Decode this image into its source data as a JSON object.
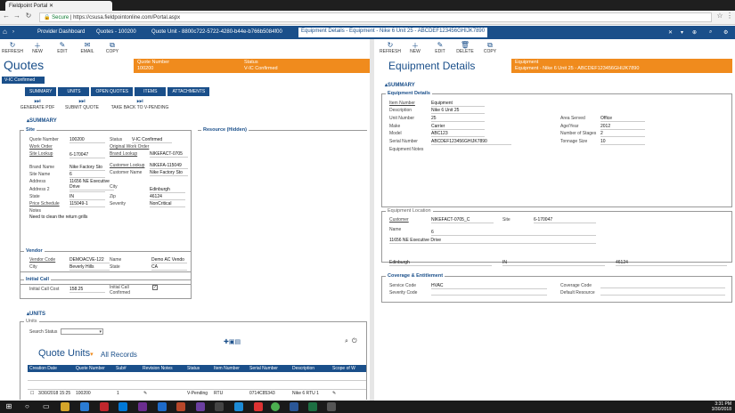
{
  "browser": {
    "tab_title": "Fieldpoint Portal",
    "secure": "Secure",
    "url": "https://csusa.fieldpointonline.com/Portal.aspx"
  },
  "appnav": {
    "items": [
      "Provider Dashboard",
      "Quotes - 100200",
      "Quote Unit - 8800c722-5722-4280-b44e-b766b5084f00",
      "Equipment Details - Equipment - Nike 6 Unit 25 - ABCDEF123456GHIJK7890"
    ]
  },
  "left": {
    "toolbar": [
      "REFRESH",
      "NEW",
      "EDIT",
      "EMAIL",
      "COPY"
    ],
    "title": "Quotes",
    "header": {
      "quote_number_label": "Quote Number",
      "quote_number": "100200",
      "status_label": "Status",
      "status": "V-IC Confirmed"
    },
    "badge": "V-IC Confirmed",
    "subtabs": [
      "SUMMARY",
      "UNITS",
      "OPEN QUOTES",
      "ITEMS",
      "ATTACHMENTS"
    ],
    "actions": [
      "GENERATE PDF",
      "SUBMIT QUOTE",
      "TAKE BACK TO V-PENDING"
    ],
    "summary_heading": "SUMMARY",
    "site_heading": "Site",
    "site": {
      "quote_number_label": "Quote Number",
      "quote_number": "100200",
      "work_order_label": "Work Order",
      "site_lookup_label": "Site Lookup",
      "site_lookup": "6-170047",
      "brand_name_label": "Brand Name",
      "brand_name": "Nike Factory Sto",
      "site_name_label": "Site Name",
      "site_name": "6",
      "address_label": "Address",
      "address": "11656 NE Executive Drive",
      "address2_label": "Address 2",
      "state_label": "State",
      "state": "IN",
      "price_schedule_label": "Price Schedule",
      "price_schedule": "115049-1",
      "notes_label": "Notes",
      "notes": "Need to clean the return grills",
      "status_label": "Status",
      "status": "V-IC Confirmed",
      "orig_wo_label": "Original Work Order",
      "brand_lookup_label": "Brand Lookup",
      "brand_lookup": "NIKEFACT-0705",
      "customer_lookup_label": "Customer Lookup",
      "customer_lookup": "NIKEFA-115049",
      "customer_name_label": "Customer Name",
      "customer_name": "Nike Factory Sto",
      "city_label": "City",
      "city": "Edinburgh",
      "zip_label": "Zip",
      "zip": "46124",
      "severity_label": "Severity",
      "severity": "NonCritical"
    },
    "resource_heading": "Resource (Hidden)",
    "vendor_heading": "Vendor",
    "vendor": {
      "vendor_code_label": "Vendor Code",
      "vendor_code": "DEMOACVE-122",
      "name_label": "Name",
      "name": "Demo AC Vendo",
      "city_label": "City",
      "city": "Beverly Hills",
      "state_label": "State",
      "state": "CA"
    },
    "initial_call_heading": "Initial Call",
    "initial_call": {
      "cost_label": "Initial Call Cost",
      "cost": "158.25",
      "confirmed_label": "Initial Call Confirmed",
      "confirmed_mark": "✓"
    },
    "units_heading": "UNITS",
    "units_group": "Units",
    "search_status_label": "Search Status",
    "quote_units_title": "Quote Units",
    "all_records": "All Records",
    "columns": [
      "Creation Date",
      "Quote Number",
      "Sub#",
      "Revision Notes",
      "Status",
      "Item Number",
      "Serial Number",
      "Description",
      "Scope of W"
    ],
    "rows": [
      [
        "3/30/2018 15:25",
        "100200",
        "1",
        "",
        "V-Pending",
        "RTU",
        "0714C85343",
        "Nike 6 RTU 1",
        ""
      ]
    ]
  },
  "right": {
    "toolbar": [
      "REFRESH",
      "NEW",
      "EDIT",
      "DELETE",
      "COPY"
    ],
    "title": "Equipment Details",
    "header_label": "Equipment",
    "header_value": "Equipment - Nike 6 Unit 25 - ABCDEF123456GHIJK7890",
    "summary_heading": "SUMMARY",
    "equip_heading": "Equipment Details",
    "equip": {
      "item_number_label": "Item Number",
      "item_number": "Equipment",
      "description_label": "Description",
      "description": "Nike 6 Unit 25",
      "unit_number_label": "Unit Number",
      "unit_number": "25",
      "make_label": "Make",
      "make": "Carrier",
      "model_label": "Model",
      "model": "ABC123",
      "serial_label": "Serial Number",
      "serial": "ABCDEF123456GHIJK7890",
      "notes_label": "Equipment Notes",
      "area_served_label": "Area Served",
      "area_served": "Office",
      "age_year_label": "Age/Year",
      "age_year": "2012",
      "stages_label": "Number of Stages",
      "stages": "2",
      "tonnage_label": "Tonnage Size",
      "tonnage": "10"
    },
    "location_heading": "Equipment Location",
    "location": {
      "customer_label": "Customer",
      "customer": "NIKEFACT-0705_C",
      "site_label": "Site",
      "site": "6-170047",
      "name_label": "Name",
      "name": "6",
      "address": "11656 NE Executive Drive",
      "city": "Edinburgh",
      "state": "IN",
      "zip": "46124"
    },
    "coverage_heading": "Coverage & Entitlement",
    "coverage": {
      "service_code_label": "Service Code",
      "service_code": "HVAC",
      "severity_code_label": "Severity Code",
      "coverage_code_label": "Coverage Code",
      "default_resource_label": "Default Resource"
    }
  },
  "taskbar": {
    "time": "3:31 PM",
    "date": "3/30/2018"
  }
}
